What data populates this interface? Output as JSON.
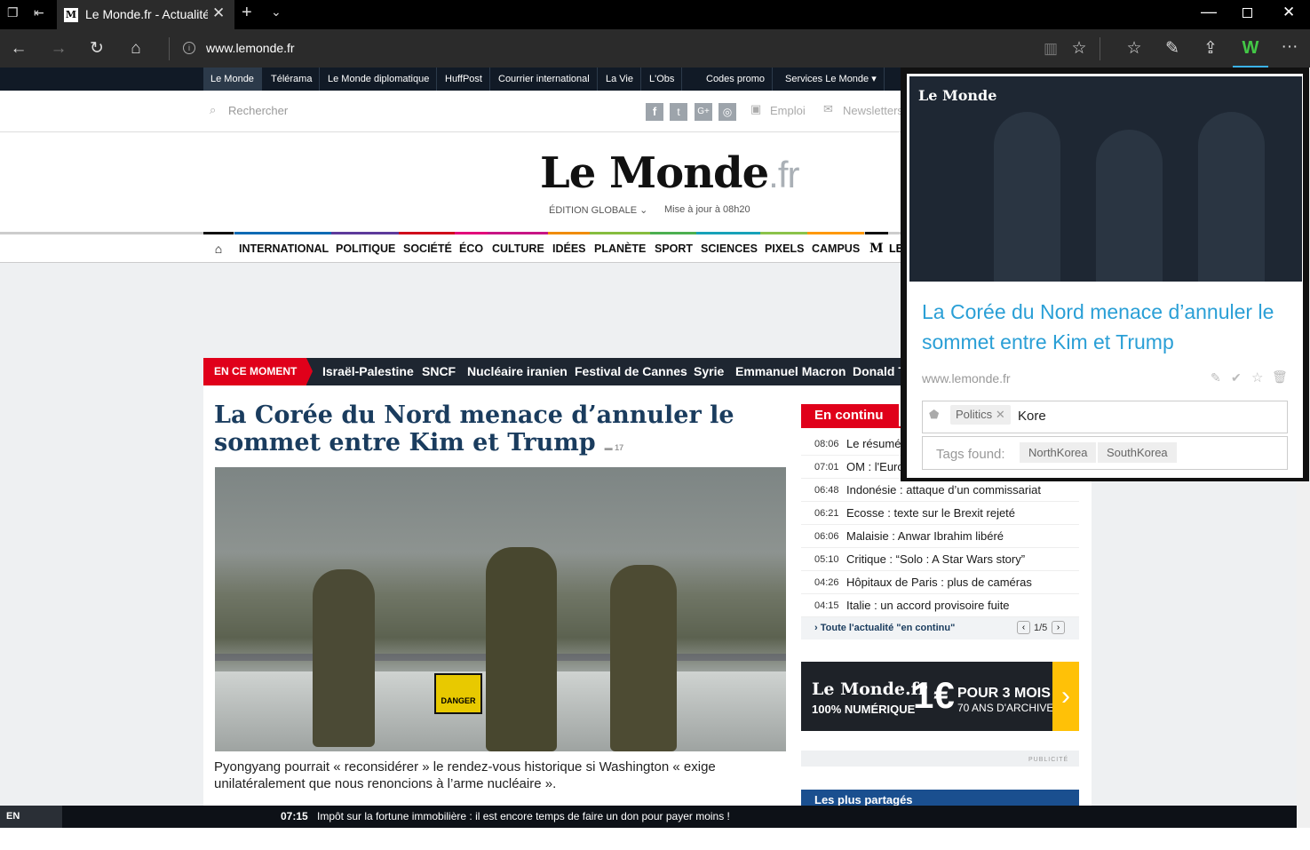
{
  "browser": {
    "tab_title": "Le Monde.fr - Actualités",
    "url": "www.lemonde.fr"
  },
  "brands": [
    "Le Monde",
    "Télérama",
    "Le Monde diplomatique",
    "HuffPost",
    "Courrier international",
    "La Vie",
    "L'Obs",
    "Codes promo",
    "Services Le Monde ▾"
  ],
  "header": {
    "search_placeholder": "Rechercher",
    "emploi": "Emploi",
    "newsletters": "Newsletters",
    "logo_main": "Le Monde",
    "logo_dot": ".fr",
    "edition": "ÉDITION GLOBALE",
    "updated": "Mise à jour à 08h20"
  },
  "nav": {
    "items": [
      {
        "label": "INTERNATIONAL",
        "color": "#0f6ab4"
      },
      {
        "label": "POLITIQUE",
        "color": "#5d3a9b"
      },
      {
        "label": "SOCIÉTÉ",
        "color": "#d0021b"
      },
      {
        "label": "ÉCO",
        "color": "#e2007a"
      },
      {
        "label": "CULTURE",
        "color": "#c71585"
      },
      {
        "label": "IDÉES",
        "color": "#f08c00"
      },
      {
        "label": "PLANÈTE",
        "color": "#86bd3e"
      },
      {
        "label": "SPORT",
        "color": "#4caf50"
      },
      {
        "label": "SCIENCES",
        "color": "#17a2b8"
      },
      {
        "label": "PIXELS",
        "color": "#8bc34a"
      },
      {
        "label": "CAMPUS",
        "color": "#ff9800"
      }
    ],
    "tail_label": "LE"
  },
  "moment": {
    "label": "EN CE MOMENT",
    "items": [
      "Israël-Palestine",
      "SNCF",
      "Nucléaire iranien",
      "Festival de Cannes",
      "Syrie",
      "Emmanuel Macron",
      "Donald T"
    ]
  },
  "article": {
    "title": "La Corée du Nord menace d’annuler le sommet entre Kim et Trump",
    "comments": "17",
    "caption": "Pyongyang pourrait « reconsidérer » le rendez-vous historique si Washington « exige unilatéralement que nous renoncions à l’arme nucléaire ».",
    "sign": "DANGER"
  },
  "continu": {
    "title": "En continu",
    "rows": [
      {
        "time": "08:06",
        "text": "Le résumé"
      },
      {
        "time": "07:01",
        "text": "OM : l'Euro"
      },
      {
        "time": "06:48",
        "text": "Indonésie : attaque d’un commissariat"
      },
      {
        "time": "06:21",
        "text": "Ecosse : texte sur le Brexit rejeté"
      },
      {
        "time": "06:06",
        "text": "Malaisie : Anwar Ibrahim libéré"
      },
      {
        "time": "05:10",
        "text": "Critique : “Solo : A Star Wars story”"
      },
      {
        "time": "04:26",
        "text": "Hôpitaux de Paris : plus de caméras"
      },
      {
        "time": "04:15",
        "text": "Italie : un accord provisoire fuite"
      }
    ],
    "all_link": "Toute l'actualité \"en continu\"",
    "pager": "1/5"
  },
  "ad": {
    "logo": "Le Monde.fr",
    "sub": "100% NUMÉRIQUE",
    "price": "1€",
    "line1": "POUR 3 MOIS",
    "line2": "70 ANS D'ARCHIVES",
    "publicite": "PUBLICITÉ"
  },
  "plus_partages": "Les plus partagés",
  "bottom": {
    "label": "EN CONTINU",
    "time": "07:15",
    "text": "Impôt sur la fortune immobilière : il est encore temps de faire un don pour payer moins !"
  },
  "popup": {
    "logo": "Le Monde",
    "title": "La Corée du Nord menace d’annuler le sommet entre Kim et Trump",
    "domain": "www.lemonde.fr",
    "tag": "Politics",
    "tag_input": "Kore",
    "tags_found_label": "Tags found:",
    "found": [
      "NorthKorea",
      "SouthKorea"
    ]
  }
}
